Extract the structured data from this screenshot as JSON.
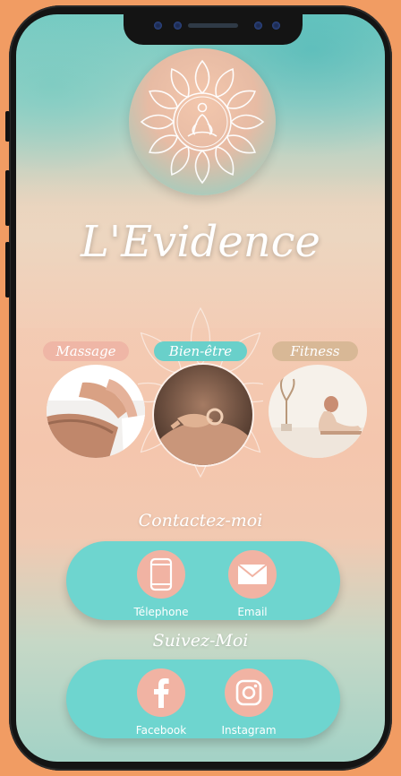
{
  "brand": {
    "title": "L'Evidence"
  },
  "services": [
    {
      "label": "Massage",
      "color": "#efb6a6"
    },
    {
      "label": "Bien-être",
      "color": "#69d0ca"
    },
    {
      "label": "Fitness",
      "color": "#d8b896"
    }
  ],
  "contact": {
    "title": "Contactez-moi",
    "phone_label": "Télephone",
    "email_label": "Email"
  },
  "social": {
    "title": "Suivez-Moi",
    "facebook_label": "Facebook",
    "instagram_label": "Instagram"
  },
  "icons": {
    "logo": "lotus-mandala-icon",
    "phone": "smartphone-icon",
    "email": "envelope-icon",
    "facebook": "facebook-icon",
    "instagram": "instagram-icon"
  },
  "colors": {
    "page_background": "#f19c63",
    "button_bar": "#6ed5cf",
    "icon_circle": "#f1b3a3"
  }
}
